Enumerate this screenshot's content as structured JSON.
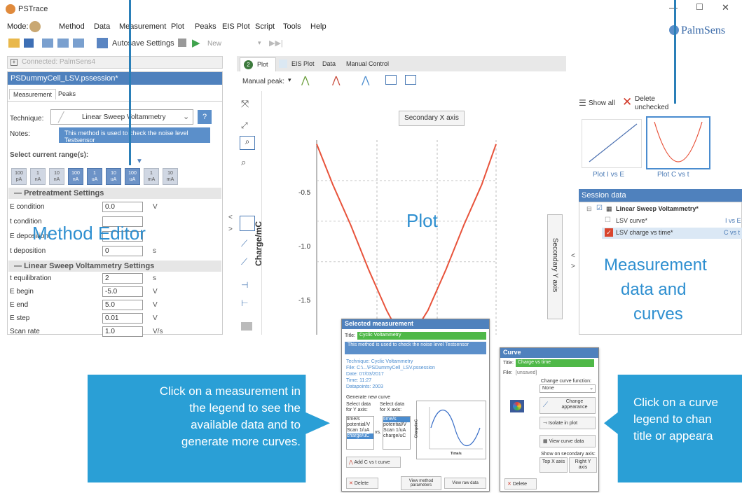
{
  "app": {
    "title": "PSTrace",
    "brand": "PalmSens"
  },
  "menu": {
    "mode_label": "Mode:",
    "items": [
      "Method",
      "Data",
      "Measurement",
      "Plot",
      "Peaks",
      "EIS Plot",
      "Script",
      "Tools",
      "Help"
    ]
  },
  "toolbar": {
    "autosave": "Autosave Settings",
    "new_label": "New"
  },
  "connection": {
    "status": "Connected: PalmSens4"
  },
  "session": {
    "file": "PSDummyCell_LSV.pssession*"
  },
  "left_tabs": [
    "Measurement",
    "Peaks"
  ],
  "method": {
    "technique_label": "Technique:",
    "technique_value": "Linear Sweep Voltammetry",
    "technique_help": "?",
    "notes_label": "Notes:",
    "notes_value": "This method is used to check the noise level Testsensor",
    "current_range_label": "Select current range(s):",
    "ranges": [
      {
        "v": "100",
        "u": "pA",
        "on": true
      },
      {
        "v": "1",
        "u": "nA",
        "on": true
      },
      {
        "v": "10",
        "u": "nA",
        "on": true
      },
      {
        "v": "100",
        "u": "nA",
        "on": false
      },
      {
        "v": "1",
        "u": "uA",
        "on": false
      },
      {
        "v": "10",
        "u": "uA",
        "on": false
      },
      {
        "v": "100",
        "u": "uA",
        "on": false
      },
      {
        "v": "1",
        "u": "mA",
        "on": true
      },
      {
        "v": "10",
        "u": "mA",
        "on": true
      }
    ],
    "pretreatment_title": "Pretreatment Settings",
    "pretreatment": [
      {
        "label": "E condition",
        "value": "0.0",
        "unit": "V"
      },
      {
        "label": "t condition",
        "value": "",
        "unit": ""
      },
      {
        "label": "E deposition",
        "value": "",
        "unit": ""
      },
      {
        "label": "t deposition",
        "value": "0",
        "unit": "s"
      }
    ],
    "lsv_title": "Linear Sweep Voltammetry Settings",
    "lsv": [
      {
        "label": "t equilibration",
        "value": "2",
        "unit": "s"
      },
      {
        "label": "E begin",
        "value": "-5.0",
        "unit": "V"
      },
      {
        "label": "E end",
        "value": "5.0",
        "unit": "V"
      },
      {
        "label": "E step",
        "value": "0.01",
        "unit": "V"
      },
      {
        "label": "Scan rate",
        "value": "1.0",
        "unit": "V/s"
      }
    ]
  },
  "plot_tabs": {
    "active": "Plot",
    "items": [
      "EIS Plot",
      "Data",
      "Manual Control"
    ]
  },
  "plot_toolbar": {
    "manual_peak": "Manual peak:"
  },
  "plot": {
    "secondary_x": "Secondary X axis",
    "secondary_y": "Secondary Y axis",
    "ylabel": "Charge/mC",
    "yticks": [
      "-0.5",
      "-1.0",
      "-1.5"
    ],
    "curve_color": "#e8533b"
  },
  "chart_data": {
    "type": "line",
    "ylabel": "Charge/mC",
    "yticks": [
      -0.5,
      -1.0,
      -1.5
    ],
    "series": [
      {
        "x": [
          0,
          0.09,
          0.19,
          0.29,
          0.39,
          0.45
        ],
        "y": [
          -0.05,
          -0.55,
          -1.05,
          -1.6,
          -2.1,
          -2.35
        ]
      },
      {
        "x": [
          0.55,
          0.62,
          0.72,
          0.82,
          0.92,
          1.0
        ],
        "y": [
          -2.35,
          -2.1,
          -1.6,
          -1.05,
          -0.55,
          -0.05
        ]
      }
    ]
  },
  "curves_panel": {
    "show_all": "Show all",
    "delete_line1": "Delete",
    "delete_line2": "unchecked",
    "thumbs": [
      "Plot I vs E",
      "Plot C vs t"
    ]
  },
  "session_data": {
    "title": "Session data",
    "root": "Linear Sweep Voltammetry*",
    "items": [
      {
        "name": "LSV curve*",
        "tag": "I vs E"
      },
      {
        "name": "LSV charge vs time*",
        "tag": "C vs t"
      }
    ]
  },
  "overlays": {
    "method_editor": "Method Editor",
    "plot": "Plot",
    "measurement": [
      "Measurement",
      "data and",
      "curves"
    ]
  },
  "selected_dialog": {
    "title": "Selected measurement",
    "title_label": "Title:",
    "title_value": "Cyclic Voltammetry",
    "notes": "This method is used to check the noise level Testsensor",
    "info": [
      "Technique: Cyclic Voltammetry",
      "File: C:\\...\\PSDummyCell_LSV.pssession",
      "Date: 07/03/2017",
      "Time: 11:27",
      "Datapoints: 2003"
    ],
    "gen_label": "Generate new curve",
    "y_label": "Select data for Y axis:",
    "x_label": "Select data for X axis:",
    "y_items": [
      "time/s",
      "potential/V",
      "Scan 1/uA",
      "charge/uC"
    ],
    "x_items": [
      "time/s",
      "potential/V",
      "Scan 1/uA",
      "charge/uC"
    ],
    "vs": "vs.",
    "mini_ylabel": "Charge/mC",
    "mini_xlabel": "Time/s",
    "add_btn": "Add C vs t curve",
    "delete_btn": "Delete",
    "view_method_btn": "View method parameters",
    "view_raw_btn": "View raw data"
  },
  "curve_dialog": {
    "title": "Curve",
    "title_label": "Title:",
    "title_value": "Charge vs time",
    "file_label": "File:",
    "file_value": "[unsaved]",
    "change_fn_label": "Change curve function:",
    "fn_value": "None",
    "change_appearance": "Change appearance",
    "isolate": "Isolate in plot",
    "view_curve": "View curve data",
    "show_secondary": "Show on secondary axis:",
    "top_x": "Top X axis",
    "right_y": "Right Y axis",
    "delete_btn": "Delete"
  },
  "callouts": {
    "left": [
      "Click on a measurement in",
      "the legend to see the",
      "available data and to",
      "generate more curves."
    ],
    "right": [
      "Click on a curve",
      "legend to chan",
      "title or appeara"
    ]
  }
}
